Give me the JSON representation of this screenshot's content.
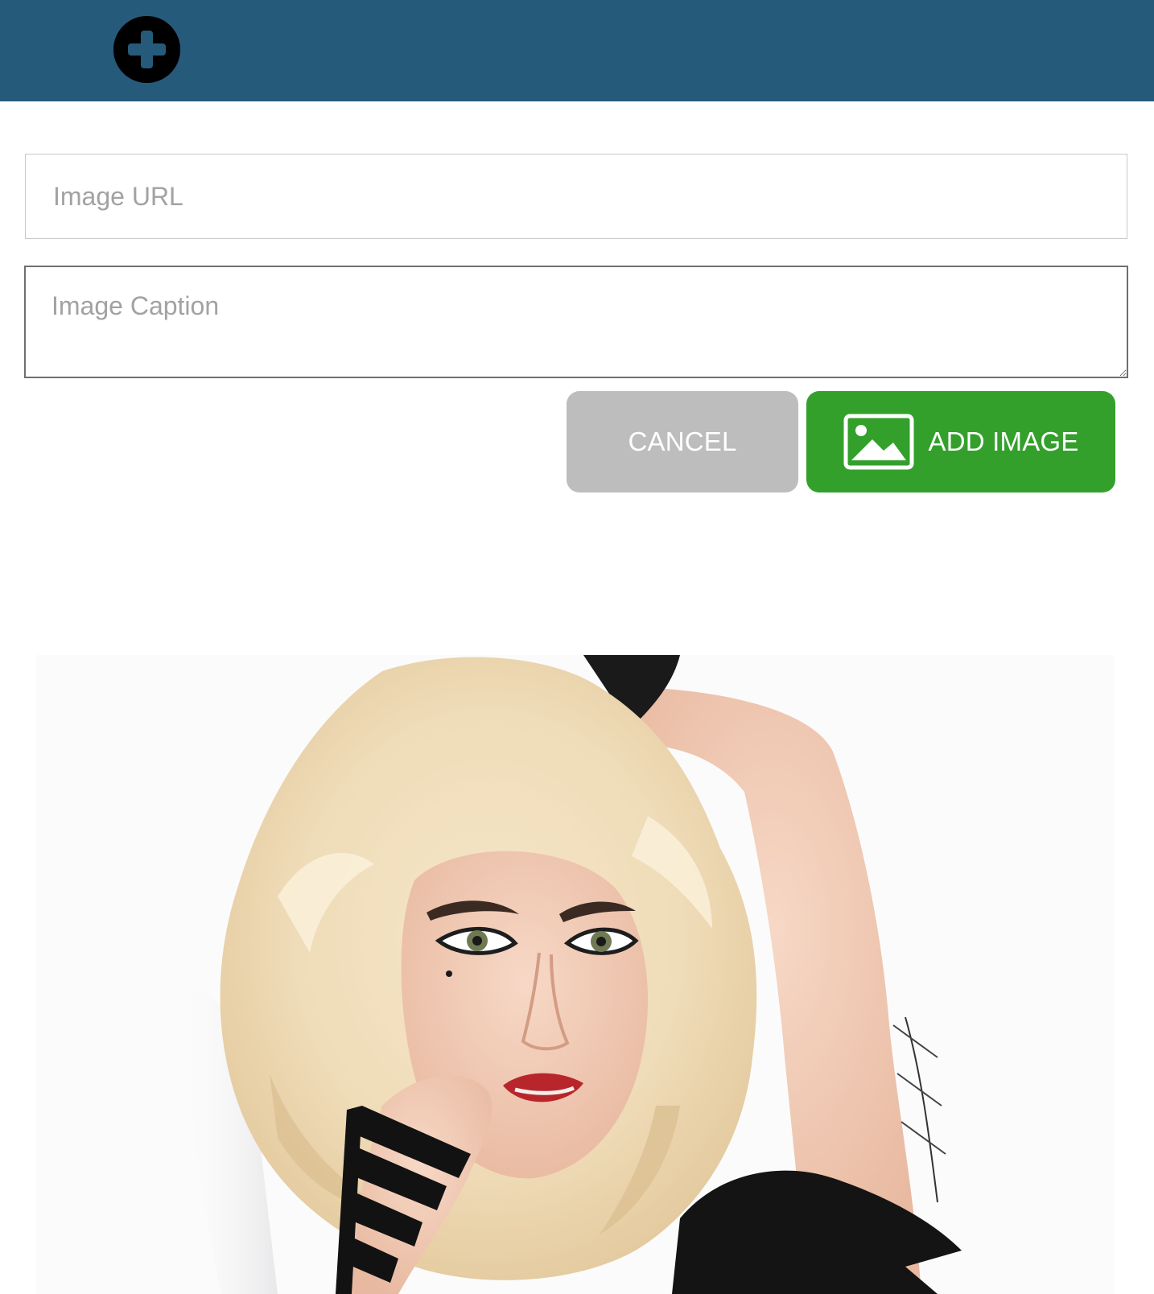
{
  "header": {
    "add_icon": "plus-circle-icon",
    "background_color": "#265a7b"
  },
  "form": {
    "url_placeholder": "Image URL",
    "url_value": "",
    "caption_placeholder": "Image Caption",
    "caption_value": "",
    "cancel_label": "CANCEL",
    "add_label": "ADD IMAGE",
    "add_icon": "image-icon",
    "cancel_color": "#bdbdbd",
    "add_color": "#33a02c"
  },
  "preview": {
    "subject": "portrait photo"
  }
}
